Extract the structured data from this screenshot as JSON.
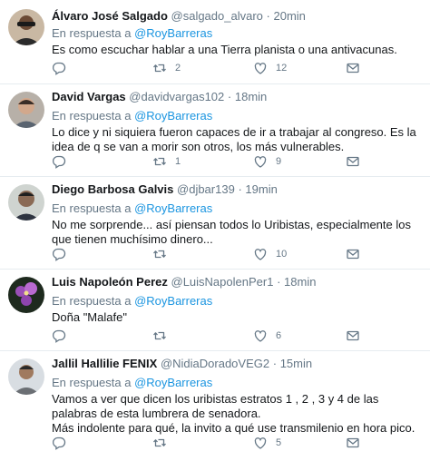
{
  "reply_prefix": "En respuesta a",
  "tweets": [
    {
      "name": "Álvaro José Salgado",
      "handle": "@salgado_alvaro",
      "separator": "·",
      "time": "20min",
      "reply_to": "",
      "text": "Es como escuchar hablar a una Tierra planista o una antivacunas.",
      "retweets": "2",
      "likes": "12"
    },
    {
      "name": "David Vargas",
      "handle": "@davidvargas102",
      "separator": "·",
      "time": "18min",
      "reply_to": "@RoyBarreras",
      "text": "Lo dice y ni siquiera fueron capaces de ir a trabajar al congreso. Es la idea de q se van a morir son otros, los más vulnerables.",
      "retweets": "1",
      "likes": "9"
    },
    {
      "name": "Diego Barbosa Galvis",
      "handle": "@djbar139",
      "separator": "·",
      "time": "19min",
      "reply_to": "@RoyBarreras",
      "text": "No me sorprende...  así piensan todos lo Uribistas, especialmente los que tienen muchísimo dinero...",
      "retweets": "",
      "likes": "10"
    },
    {
      "name": "Luis Napoleón Perez",
      "handle": "@LuisNapolenPer1",
      "separator": "·",
      "time": "18min",
      "reply_to": "@RoyBarreras",
      "text": "Doña \"Malafe\"",
      "retweets": "",
      "likes": "6"
    },
    {
      "name": "Jallil Hallilie FENIX",
      "handle": "@NidiaDoradoVEG2",
      "separator": "·",
      "time": "15min",
      "reply_to": "@RoyBarreras",
      "text": "Vamos a ver que dicen los uribistas estratos 1 , 2 , 3 y 4 de las palabras de esta lumbrera de senadora.\nMás indolente para qué, la invito a qué use transmilenio en hora pico.",
      "retweets": "",
      "likes": "5"
    }
  ],
  "first_reply_mention": "@RoyBarreras",
  "icons": {
    "reply": "reply-icon",
    "retweet": "retweet-icon",
    "like": "heart-icon",
    "message": "direct-message-icon"
  },
  "colors": {
    "link": "#1b95e0",
    "secondary_text": "#657786",
    "divider": "#e6ecf0"
  }
}
